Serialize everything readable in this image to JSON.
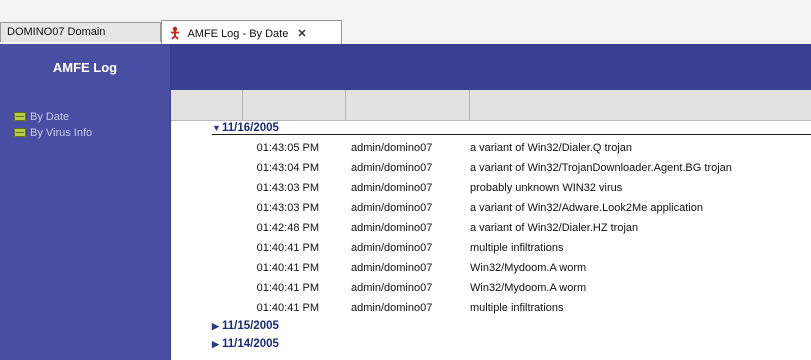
{
  "tabs": [
    {
      "label": "DOMINO07 Domain"
    },
    {
      "label": "AMFE Log - By Date",
      "close": "✕"
    }
  ],
  "sidebar": {
    "title": "AMFE Log",
    "items": [
      {
        "label": "By Date",
        "icon": "log-view-icon"
      },
      {
        "label": "By Virus Info",
        "icon": "log-view-icon"
      }
    ]
  },
  "groups": [
    {
      "date": "11/16/2005",
      "expanded": true,
      "rows": [
        {
          "time": "01:43:05 PM",
          "user": "admin/domino07",
          "info": "a variant of Win32/Dialer.Q trojan"
        },
        {
          "time": "01:43:04 PM",
          "user": "admin/domino07",
          "info": "a variant of Win32/TrojanDownloader.Agent.BG trojan"
        },
        {
          "time": "01:43:03 PM",
          "user": "admin/domino07",
          "info": "probably unknown WIN32 virus"
        },
        {
          "time": "01:43:03 PM",
          "user": "admin/domino07",
          "info": "a variant of Win32/Adware.Look2Me application"
        },
        {
          "time": "01:42:48 PM",
          "user": "admin/domino07",
          "info": "a variant of Win32/Dialer.HZ trojan"
        },
        {
          "time": "01:40:41 PM",
          "user": "admin/domino07",
          "info": "multiple infiltrations"
        },
        {
          "time": "01:40:41 PM",
          "user": "admin/domino07",
          "info": "Win32/Mydoom.A worm"
        },
        {
          "time": "01:40:41 PM",
          "user": "admin/domino07",
          "info": "Win32/Mydoom.A worm"
        },
        {
          "time": "01:40:41 PM",
          "user": "admin/domino07",
          "info": "multiple infiltrations"
        }
      ]
    },
    {
      "date": "11/15/2005",
      "expanded": false,
      "rows": []
    },
    {
      "date": "11/14/2005",
      "expanded": false,
      "rows": []
    }
  ],
  "colors": {
    "sidebar": "#4a4ea3",
    "frame": "#3b3f94",
    "group_text": "#1a2b7a"
  }
}
